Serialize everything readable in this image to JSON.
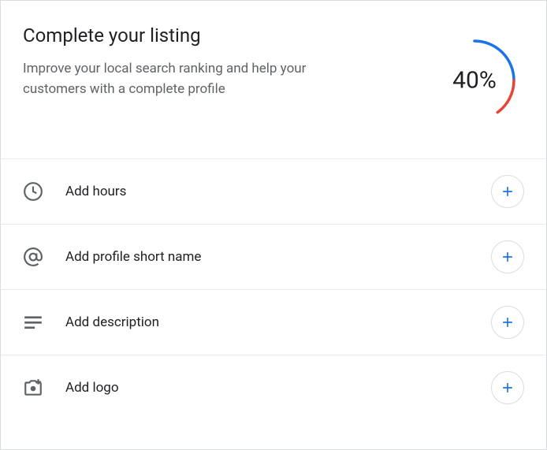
{
  "header": {
    "title": "Complete your listing",
    "subtitle": "Improve your local search ranking and help your customers with a complete profile",
    "progress_percent": "40%",
    "progress_value": 40
  },
  "items": [
    {
      "icon": "clock-icon",
      "label": "Add hours"
    },
    {
      "icon": "at-icon",
      "label": "Add profile short name"
    },
    {
      "icon": "description-icon",
      "label": "Add description"
    },
    {
      "icon": "camera-plus-icon",
      "label": "Add logo"
    }
  ]
}
